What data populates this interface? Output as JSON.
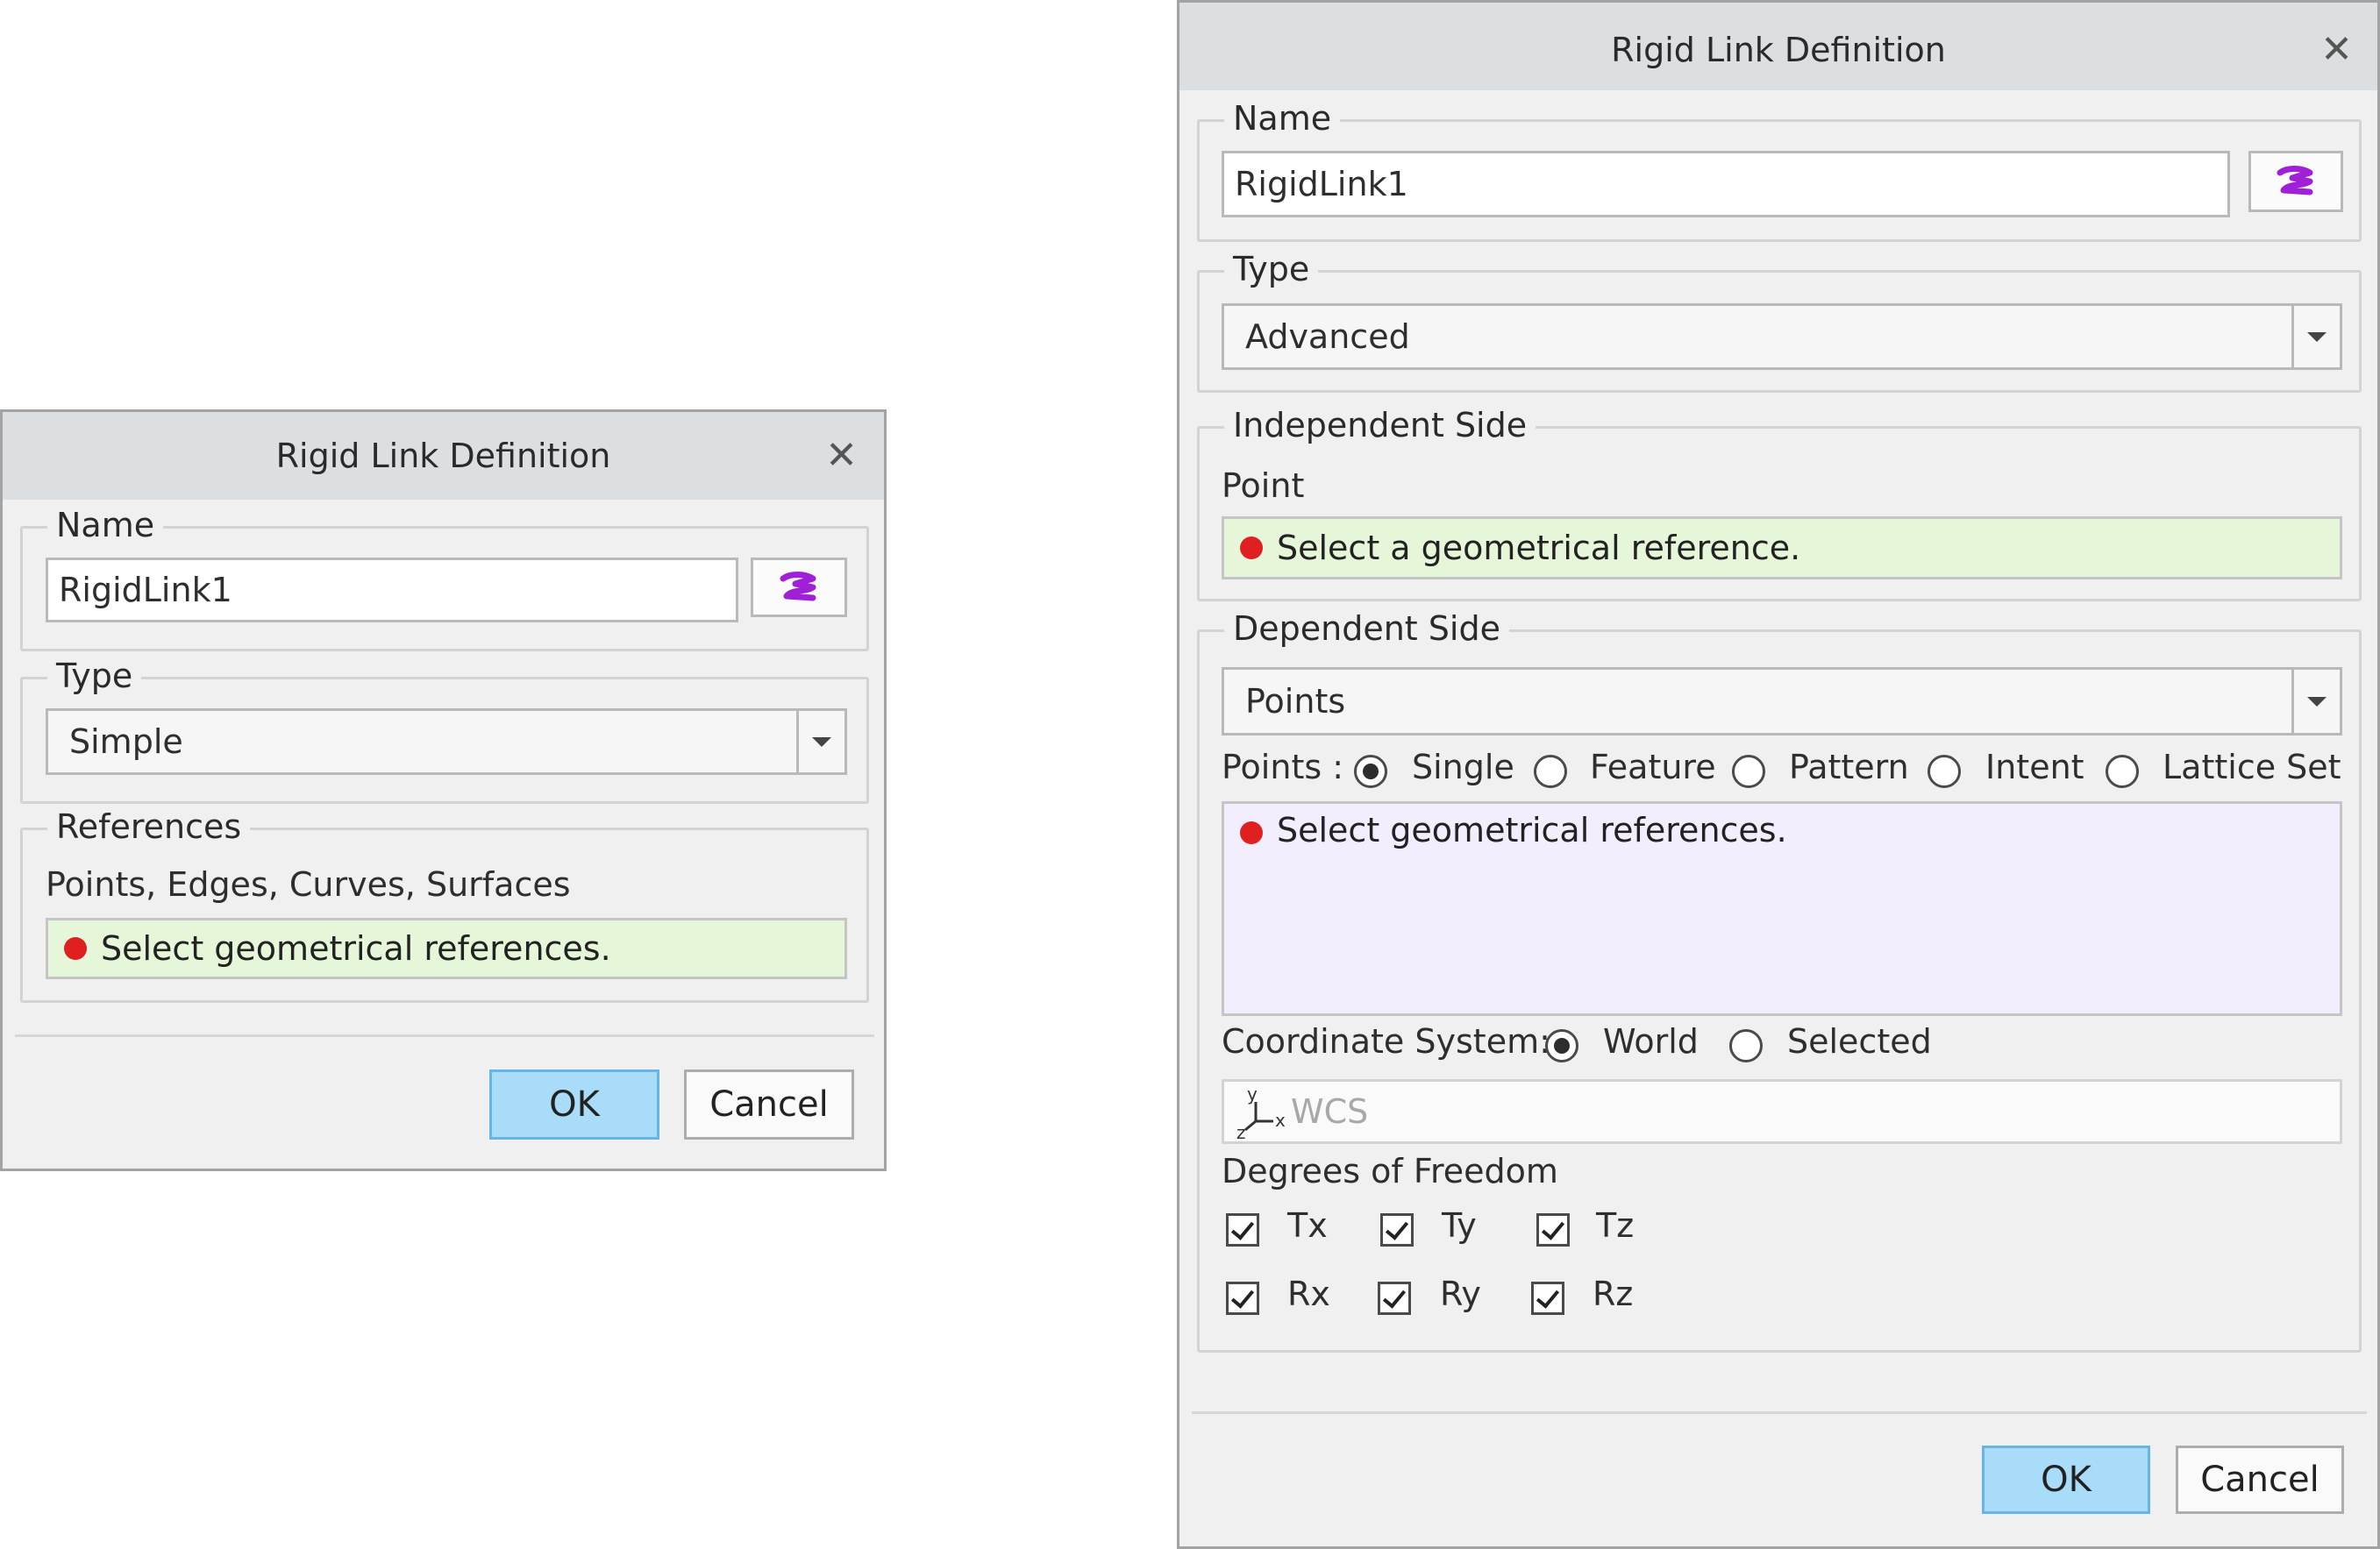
{
  "simple_dialog": {
    "title": "Rigid Link Definition",
    "name_group": {
      "legend": "Name",
      "value": "RigidLink1"
    },
    "type_group": {
      "legend": "Type",
      "selected": "Simple"
    },
    "references_group": {
      "legend": "References",
      "filter_text": "Points, Edges, Curves, Surfaces",
      "collector_text": "Select geometrical references."
    },
    "ok_label": "OK",
    "cancel_label": "Cancel"
  },
  "advanced_dialog": {
    "title": "Rigid Link Definition",
    "name_group": {
      "legend": "Name",
      "value": "RigidLink1"
    },
    "type_group": {
      "legend": "Type",
      "selected": "Advanced"
    },
    "independent_group": {
      "legend": "Independent Side",
      "filter_label": "Point",
      "collector_text": "Select a geometrical reference."
    },
    "dependent_group": {
      "legend": "Dependent Side",
      "selected": "Points",
      "points_label": "Points :",
      "point_options": [
        "Single",
        "Feature",
        "Pattern",
        "Intent",
        "Lattice Set"
      ],
      "selected_point_option": "Single",
      "collector_text": "Select geometrical references.",
      "coord_system_label": "Coordinate System:",
      "coord_options": [
        "World",
        "Selected"
      ],
      "selected_coord_option": "World",
      "csys_value": "WCS",
      "dof_label": "Degrees of Freedom",
      "dof": [
        {
          "label": "Tx",
          "checked": true
        },
        {
          "label": "Ty",
          "checked": true
        },
        {
          "label": "Tz",
          "checked": true
        },
        {
          "label": "Rx",
          "checked": true
        },
        {
          "label": "Ry",
          "checked": true
        },
        {
          "label": "Rz",
          "checked": true
        }
      ]
    },
    "ok_label": "OK",
    "cancel_label": "Cancel"
  },
  "icons": {
    "close": "close-icon",
    "auto_name": "auto-name-icon",
    "dropdown": "chevron-down-icon",
    "status_required": "red-dot-icon",
    "csys": "coordinate-system-icon"
  },
  "colors": {
    "ok_button": "#a8dcf8",
    "collector_green": "#e6f6d8",
    "collector_purple": "#f3eefd",
    "status_red": "#e02020",
    "auto_name_icon": "#a020d8"
  }
}
